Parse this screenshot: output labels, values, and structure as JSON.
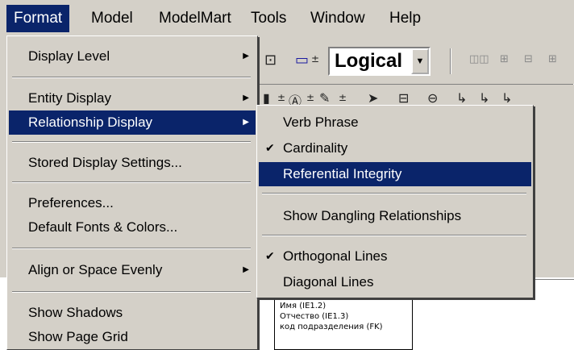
{
  "menubar": {
    "items": [
      "Format",
      "Model",
      "ModelMart",
      "Tools",
      "Window",
      "Help"
    ]
  },
  "toolbar": {
    "combo_value": "Logical"
  },
  "format_menu": {
    "display_level": "Display Level",
    "entity_display": "Entity Display",
    "relationship_display": "Relationship Display",
    "stored_display_settings": "Stored Display Settings...",
    "preferences": "Preferences...",
    "default_fonts_colors": "Default Fonts & Colors...",
    "align_space_evenly": "Align or Space Evenly",
    "show_shadows": "Show Shadows",
    "show_page_grid": "Show Page Grid"
  },
  "relationship_submenu": {
    "verb_phrase": "Verb Phrase",
    "cardinality": "Cardinality",
    "referential_integrity": "Referential Integrity",
    "show_dangling": "Show Dangling Relationships",
    "orthogonal_lines": "Orthogonal Lines",
    "diagonal_lines": "Diagonal Lines",
    "check_mark": "✔"
  },
  "entity_box": {
    "lines": [
      "Имя (IE1.2)",
      "Отчество (IE1.3)",
      "код подразделения (FK)"
    ]
  },
  "colors": {
    "menu_bg": "#d4d0c8",
    "highlight": "#0a246a"
  }
}
